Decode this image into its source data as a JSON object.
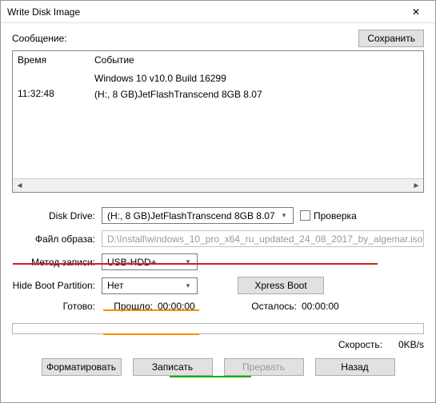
{
  "window": {
    "title": "Write Disk Image"
  },
  "message": {
    "label": "Сообщение:",
    "save_btn": "Сохранить"
  },
  "log": {
    "col_time": "Время",
    "col_event": "Событие",
    "rows": [
      {
        "time": "",
        "ev1": "Windows 10 v10.0 Build 16299",
        "ev2": ""
      },
      {
        "time": "11:32:48",
        "ev1": "(H:, 8 GB)JetFlashTranscend 8GB   8.07",
        "ev2": ""
      }
    ]
  },
  "form": {
    "drive_label": "Disk Drive:",
    "drive_value": "(H:, 8 GB)JetFlashTranscend 8GB   8.07",
    "check_label": "Проверка",
    "file_label": "Файл образа:",
    "file_value": "D:\\Install\\windows_10_pro_x64_ru_updated_24_08_2017_by_algemar.iso",
    "method_label": "Метод записи:",
    "method_value": "USB-HDD+",
    "hide_label": "Hide Boot Partition:",
    "hide_value": "Нет",
    "xpress_btn": "Xpress Boot"
  },
  "time": {
    "ready_label": "Готово:",
    "elapsed_label": "Прошло:",
    "elapsed_value": "00:00:00",
    "remain_label": "Осталось:",
    "remain_value": "00:00:00"
  },
  "speed": {
    "label": "Скорость:",
    "value": "0KB/s"
  },
  "buttons": {
    "format": "Форматировать",
    "write": "Записать",
    "abort": "Прервать",
    "back": "Назад"
  }
}
